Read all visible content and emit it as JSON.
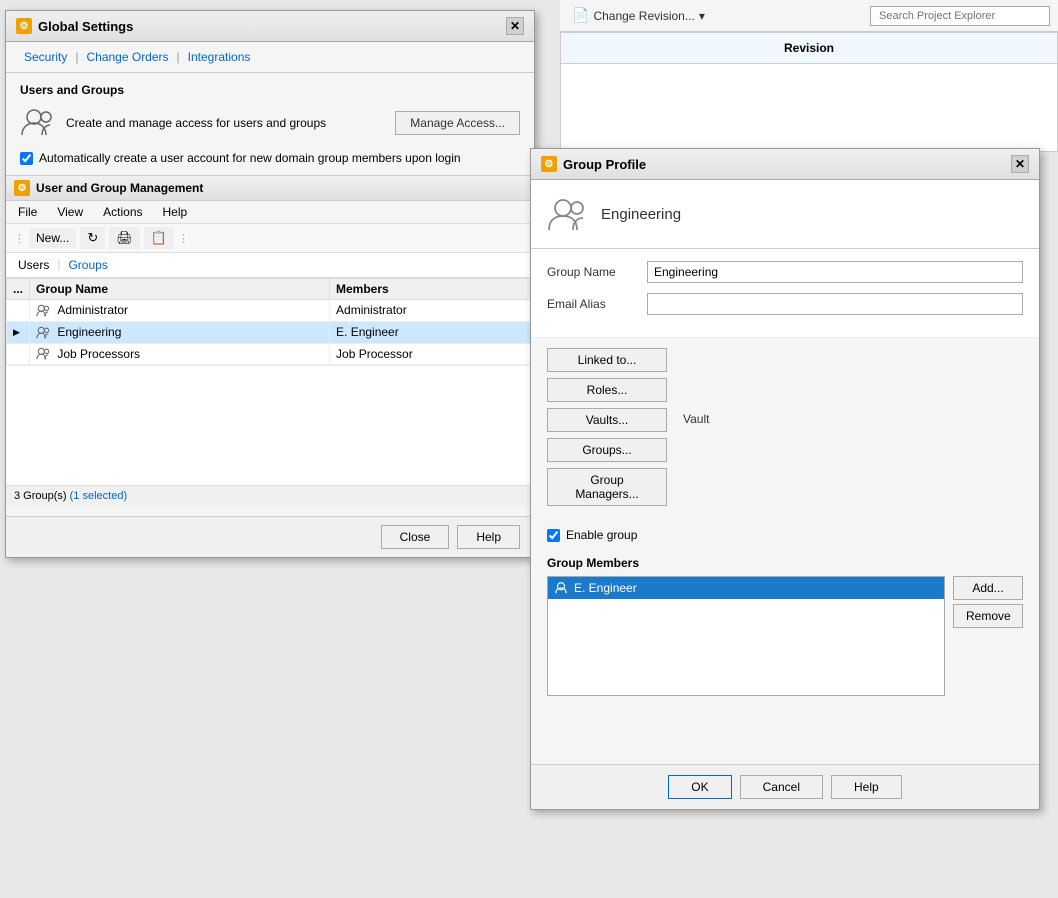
{
  "app": {
    "title": "Global Settings",
    "icon": "gear-icon"
  },
  "topbar": {
    "change_revision_label": "Change Revision...",
    "dropdown_icon": "▾",
    "search_placeholder": "Search Project Explorer"
  },
  "revision_panel": {
    "header": "Revision"
  },
  "global_settings": {
    "title": "Global Settings",
    "nav_tabs": [
      {
        "label": "Security"
      },
      {
        "label": "Change Orders"
      },
      {
        "label": "Integrations"
      }
    ],
    "section_label": "Users and Groups",
    "description": "Create and manage access for users and groups",
    "manage_access_btn": "Manage Access...",
    "checkbox_label": "Automatically create a user account for new domain group members upon login",
    "close_btn": "Close",
    "help_btn": "Help"
  },
  "ugm": {
    "title": "User and Group Management",
    "menu": [
      "File",
      "View",
      "Actions",
      "Help"
    ],
    "toolbar": [
      "New...",
      "↻",
      "🖨",
      "📋"
    ],
    "tabs": [
      "Users",
      "Groups"
    ],
    "columns": [
      "...",
      "Group Name",
      "Members"
    ],
    "rows": [
      {
        "icon": "users-icon",
        "name": "Administrator",
        "members": "Administrator",
        "selected": false,
        "expandable": false
      },
      {
        "icon": "users-icon",
        "name": "Engineering",
        "members": "E. Engineer",
        "selected": true,
        "expandable": true
      },
      {
        "icon": "users-icon",
        "name": "Job Processors",
        "members": "Job Processor",
        "selected": false,
        "expandable": false
      }
    ],
    "status": "3 Group(s)",
    "status_selected": "(1 selected)"
  },
  "group_profile": {
    "title": "Group Profile",
    "group_display_name": "Engineering",
    "group_name_label": "Group Name",
    "group_name_value": "Engineering",
    "email_alias_label": "Email Alias",
    "email_alias_value": "",
    "buttons": [
      {
        "label": "Linked to..."
      },
      {
        "label": "Roles..."
      },
      {
        "label": "Vaults..."
      },
      {
        "label": "Groups..."
      },
      {
        "label": "Group Managers..."
      }
    ],
    "vault_label": "Vault",
    "enable_group_label": "Enable group",
    "enable_group_checked": true,
    "members_section_label": "Group Members",
    "members": [
      {
        "name": "E. Engineer",
        "selected": true
      }
    ],
    "add_btn": "Add...",
    "remove_btn": "Remove",
    "ok_btn": "OK",
    "cancel_btn": "Cancel",
    "help_btn": "Help"
  }
}
